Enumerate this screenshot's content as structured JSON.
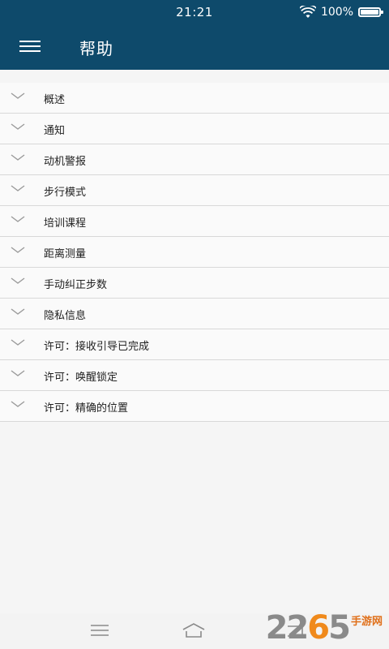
{
  "status_bar": {
    "time": "21:21",
    "battery_text": "100%",
    "icons": [
      "wifi-icon",
      "battery-icon"
    ]
  },
  "app_bar": {
    "title": "帮助",
    "menu_icon": "hamburger-menu-icon",
    "background": "#0e4a6b"
  },
  "help_items": [
    {
      "label": "概述"
    },
    {
      "label": "通知"
    },
    {
      "label": "动机警报"
    },
    {
      "label": "步行模式"
    },
    {
      "label": "培训课程"
    },
    {
      "label": "距离测量"
    },
    {
      "label": "手动纠正步数"
    },
    {
      "label": "隐私信息"
    },
    {
      "label": "许可：接收引导已完成"
    },
    {
      "label": "许可：唤醒锁定"
    },
    {
      "label": "许可：精确的位置"
    }
  ],
  "nav_bar": {
    "icons": [
      "menu-icon",
      "home-icon",
      "back-icon"
    ]
  },
  "watermark": {
    "number": "2265",
    "text": "手游网"
  }
}
